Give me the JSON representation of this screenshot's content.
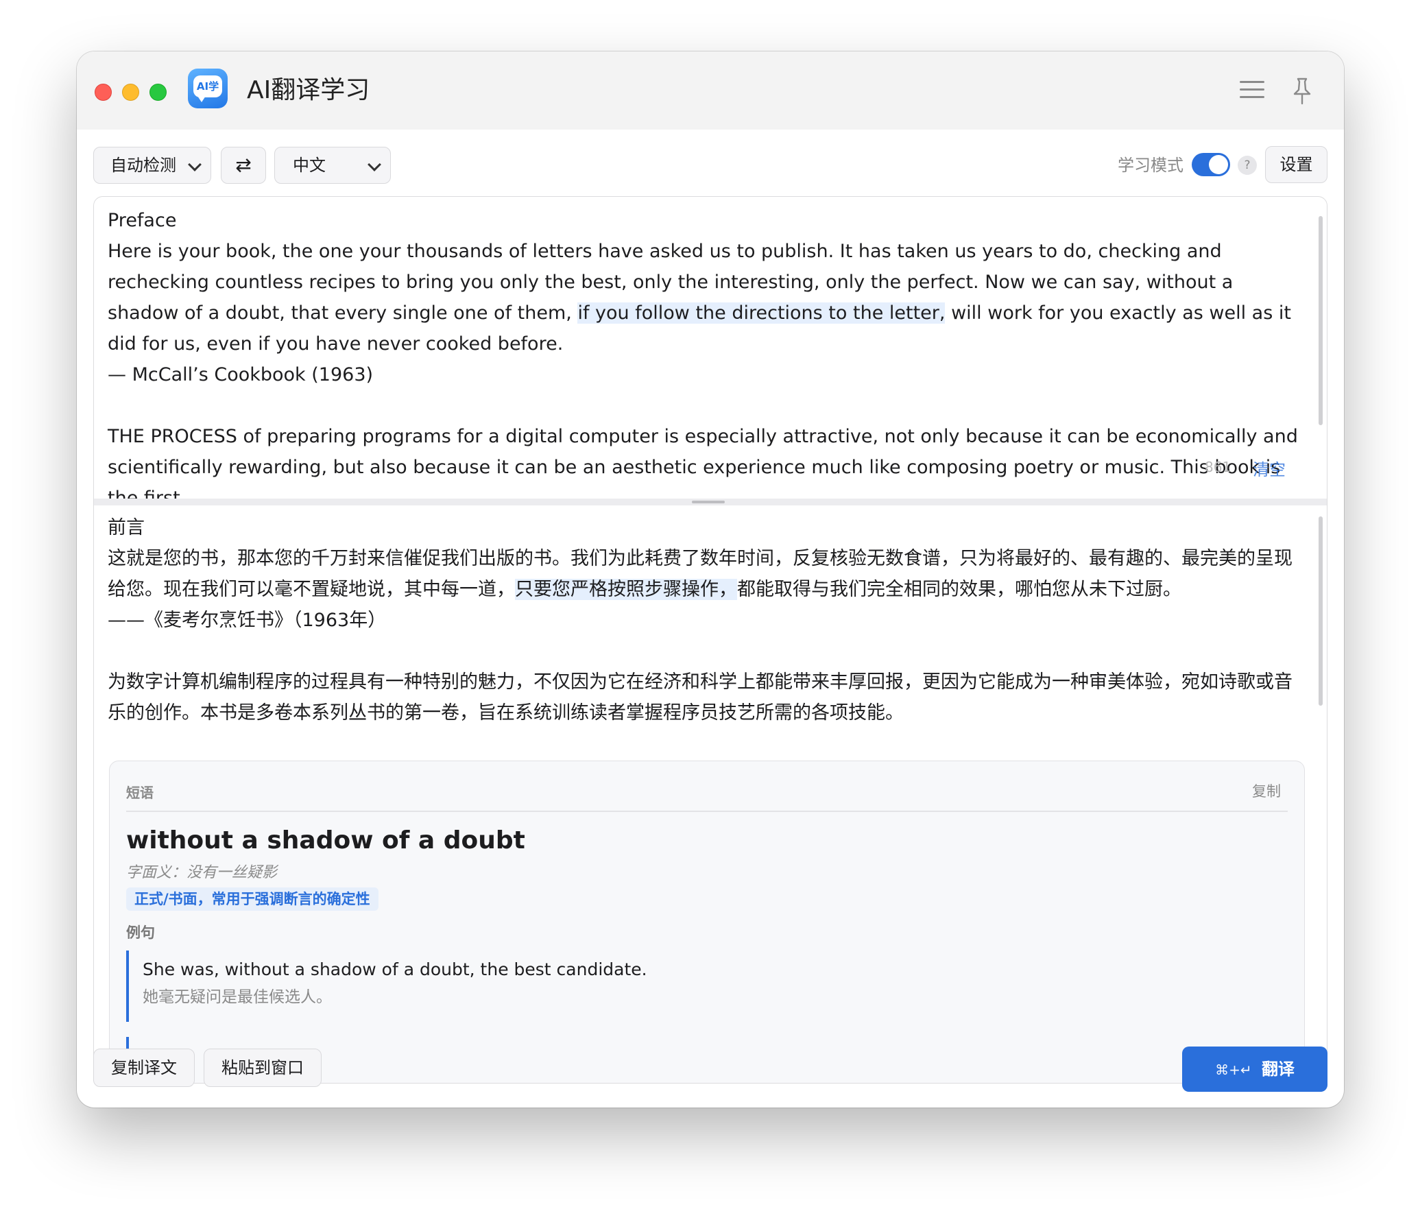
{
  "window": {
    "app_title": "AI翻译学习",
    "app_icon_text": "AI学"
  },
  "toolbar": {
    "source_language": "自动检测",
    "swap_label": "⇄",
    "target_language": "中文",
    "learning_mode_label": "学习模式",
    "learning_mode_on": true,
    "help_label": "?",
    "settings_label": "设置"
  },
  "source": {
    "line1": "Preface",
    "line2_pre": "Here is your book, the one your thousands of letters have asked us to publish. It has taken us years to do, checking and rechecking countless recipes to bring you only the best, only the interesting, only the perfect. Now we can say, without a shadow of a doubt, that every single one of them, ",
    "line2_hl": "if you follow the directions to the letter,",
    "line2_post": " will work for you exactly as well as it did for us, even if you have never cooked before.",
    "line3": "— McCall’s Cookbook (1963)",
    "line4": "THE PROCESS of preparing programs for a digital computer is especially attractive, not only because it can be economically and scientifically rewarding, but also because it can be an aesthetic experience much like composing poetry or music. This book is the first",
    "char_count": "861",
    "clear_label": "清空"
  },
  "target": {
    "line1": "前言",
    "line2_pre": "这就是您的书，那本您的千万封来信催促我们出版的书。我们为此耗费了数年时间，反复核验无数食谱，只为将最好的、最有趣的、最完美的呈现给您。现在我们可以毫不置疑地说，其中每一道，",
    "line2_hl": "只要您严格按照步骤操作，",
    "line2_post": "都能取得与我们完全相同的效果，哪怕您从未下过厨。",
    "line3": "——《麦考尔烹饪书》（1963年）",
    "line4": "为数字计算机编制程序的过程具有一种特别的魅力，不仅因为它在经济和科学上都能带来丰厚回报，更因为它能成为一种审美体验，宛如诗歌或音乐的创作。本书是多卷本系列丛书的第一卷，旨在系统训练读者掌握程序员技艺所需的各项技能。"
  },
  "phrase_card": {
    "type_label": "短语",
    "copy_label": "复制",
    "term": "without a shadow of a doubt",
    "literal": "字面义：没有一丝疑影",
    "register_tag": "正式/书面，常用于强调断言的确定性",
    "examples_label": "例句",
    "example_en": "She was, without a shadow of a doubt, the best candidate.",
    "example_zh": "她毫无疑问是最佳候选人。"
  },
  "bottom": {
    "copy_translation_label": "复制译文",
    "paste_label": "粘贴到窗口",
    "shortcut_label": "⌘+↵",
    "translate_label": "翻译"
  },
  "colors": {
    "accent": "#2a6fdb",
    "highlight": "#e5effd"
  }
}
